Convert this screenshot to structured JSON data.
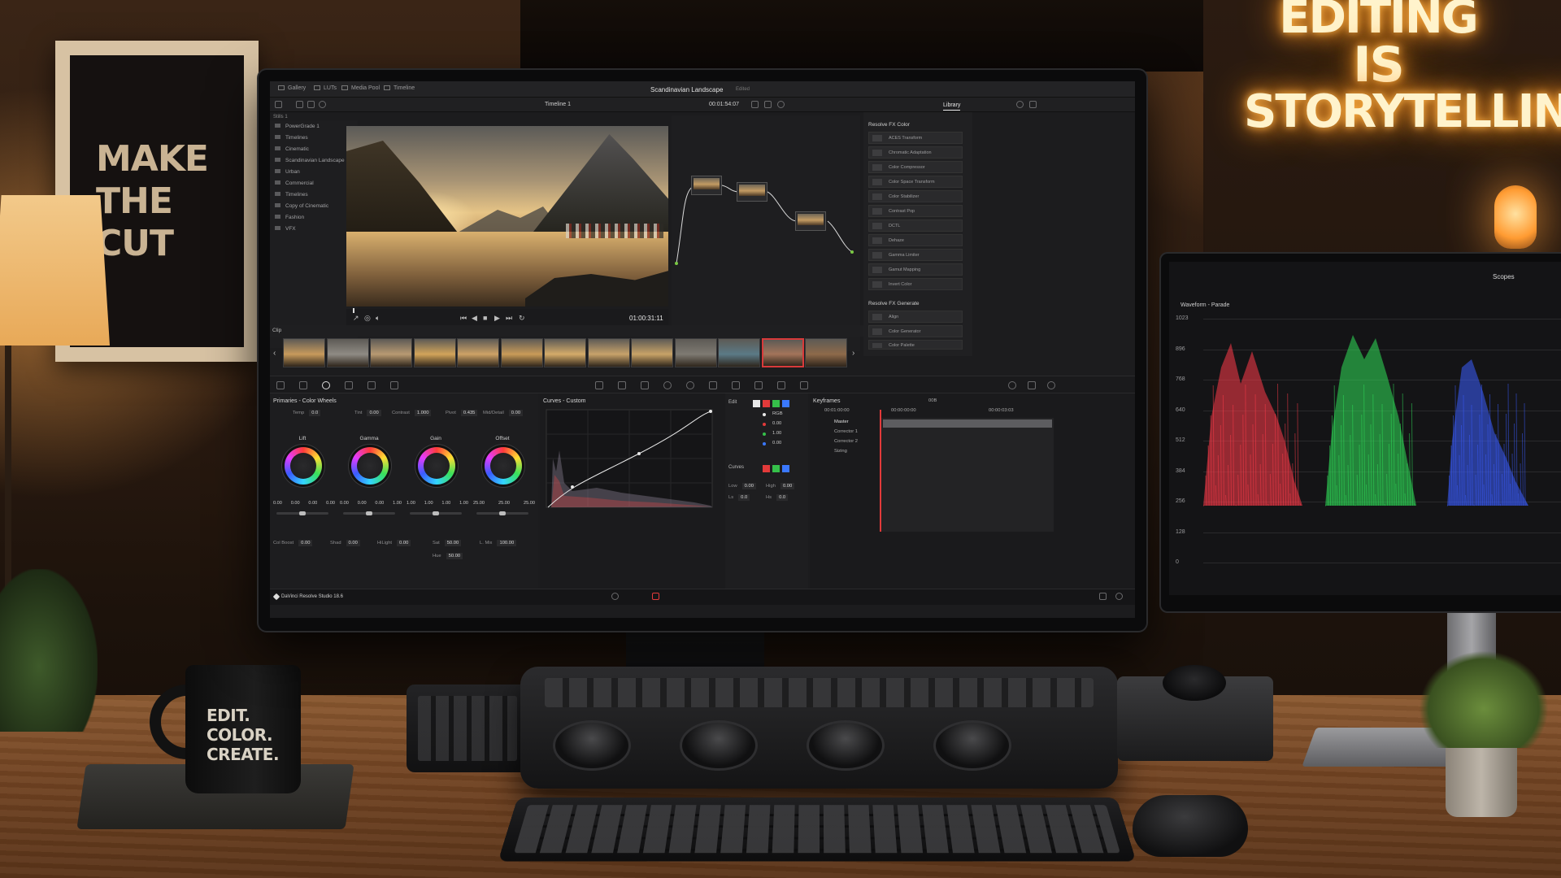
{
  "room": {
    "poster_lines": [
      "MAKE",
      "THE",
      "CUT"
    ],
    "neon_lines": [
      "EDITING",
      "IS",
      "STORYTELLING"
    ],
    "mug_lines": [
      "EDIT.",
      "COLOR.",
      "CREATE."
    ]
  },
  "app": {
    "top_tabs": [
      "Gallery",
      "LUTs",
      "Media Pool",
      "Timeline"
    ],
    "project_title": "Scandinavian Landscape",
    "project_status": "Edited",
    "timeline_name": "Timeline 1",
    "timecode_top": "00:01:54:07",
    "library_tab": "Library",
    "viewer_timecode": "01:00:31:11",
    "status_text": "DaVinci Resolve Studio 18.6"
  },
  "stills": {
    "header": "Stills 1",
    "items": [
      "PowerGrade 1",
      "Timelines",
      "Cinematic",
      "Scandinavian Landscape",
      "Urban",
      "Commercial",
      "Timelines",
      "Copy of Cinematic",
      "Fashion",
      "VFX"
    ]
  },
  "library": {
    "section1": "Resolve FX Color",
    "items1": [
      "ACES Transform",
      "Chromatic Adaptation",
      "Color Compressor",
      "Color Space Transform",
      "Color Stabilizer",
      "Contrast Pop",
      "DCTL",
      "Dehaze",
      "Gamma Limiter",
      "Gamut Mapping",
      "Invert Color"
    ],
    "section2": "Resolve FX Generate",
    "items2": [
      "Align",
      "Color Generator",
      "Color Palette"
    ]
  },
  "clips": {
    "label": "Clip",
    "count": 13,
    "selected_index": 11
  },
  "primaries": {
    "title": "Primaries - Color Wheels",
    "top_params": [
      {
        "label": "Temp",
        "value": "0.0"
      },
      {
        "label": "Tint",
        "value": "0.00"
      },
      {
        "label": "Contrast",
        "value": "1.000"
      },
      {
        "label": "Pivot",
        "value": "0.435"
      },
      {
        "label": "Mid/Detail",
        "value": "0.00"
      }
    ],
    "wheels": [
      {
        "name": "Lift",
        "values": [
          "0.00",
          "0.00",
          "0.00",
          "0.00"
        ]
      },
      {
        "name": "Gamma",
        "values": [
          "0.00",
          "0.00",
          "0.00",
          "1.00"
        ]
      },
      {
        "name": "Gain",
        "values": [
          "1.00",
          "1.00",
          "1.00",
          "1.00"
        ]
      },
      {
        "name": "Offset",
        "values": [
          "25.00",
          "25.00",
          "25.00"
        ]
      }
    ],
    "bottom_params": [
      {
        "label": "Col Boost",
        "value": "0.00"
      },
      {
        "label": "Shad",
        "value": "0.00"
      },
      {
        "label": "HiLight",
        "value": "0.00"
      },
      {
        "label": "Sat",
        "value": "50.00"
      },
      {
        "label": "Hue",
        "value": "50.00"
      },
      {
        "label": "L. Mix",
        "value": "100.00"
      }
    ]
  },
  "curves": {
    "title": "Curves - Custom",
    "edit_label": "Edit",
    "channels": [
      {
        "label": "RGB",
        "color": "#e8e8e8"
      },
      {
        "label": "0.00",
        "color": "#e23a3a"
      },
      {
        "label": "1.00",
        "color": "#35c04a"
      },
      {
        "label": "0.00",
        "color": "#3a78ff"
      }
    ],
    "softclip_label": "Curves",
    "soft_params": [
      {
        "label": "Low",
        "value": "0.00"
      },
      {
        "label": "High",
        "value": "0.00"
      },
      {
        "label": "Ls",
        "value": "0.0"
      },
      {
        "label": "Hs",
        "value": "0.0"
      }
    ]
  },
  "keyframes": {
    "title": "Keyframes",
    "zoom": "00B",
    "tc_start": "00:01:00:00",
    "tc_mid": "00:00:00:00",
    "tc_end": "00:00:03:03",
    "rows": [
      "Master",
      "Corrector 1",
      "Corrector 2",
      "Sizing"
    ]
  },
  "scopes": {
    "title": "Scopes",
    "mode": "Waveform - Parade",
    "ticks": [
      "1023",
      "896",
      "768",
      "640",
      "512",
      "384",
      "256",
      "128",
      "0"
    ],
    "colors": {
      "red": "#ff3b4a",
      "green": "#2fe05a",
      "blue": "#3a5cff"
    }
  }
}
